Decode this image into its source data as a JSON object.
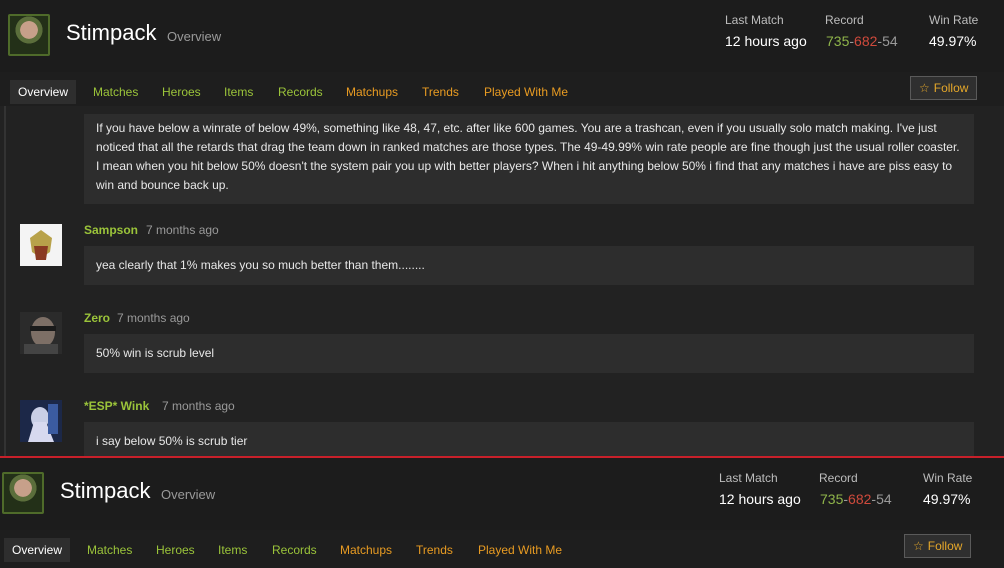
{
  "profile": {
    "name": "Stimpack",
    "section": "Overview",
    "stats": {
      "last_match_label": "Last Match",
      "last_match_value": "12 hours ago",
      "record_label": "Record",
      "record_wins": "735",
      "record_losses": "682",
      "record_abandons": "54",
      "record_sep": "-",
      "win_rate_label": "Win Rate",
      "win_rate_value": "49.97%"
    }
  },
  "nav": {
    "tabs": [
      {
        "label": "Overview"
      },
      {
        "label": "Matches"
      },
      {
        "label": "Heroes"
      },
      {
        "label": "Items"
      },
      {
        "label": "Records"
      },
      {
        "label": "Matchups"
      },
      {
        "label": "Trends"
      },
      {
        "label": "Played With Me"
      }
    ],
    "follow_label": "Follow"
  },
  "comments": [
    {
      "text": "If you have below a winrate of below 49%, something like 48, 47, etc. after like 600 games. You are a trashcan, even if you usually solo match making. I've just noticed that all the retards that drag the team down in ranked matches are those types. The 49-49.99% win rate people are fine though just the usual roller coaster. I mean when you hit below 50% doesn't the system pair you up with better players? When i hit anything below 50% i find that any matches i have are piss easy to win and bounce back up."
    },
    {
      "author": "Sampson",
      "time": "7 months ago",
      "text": "yea clearly that 1% makes you so much better than them........"
    },
    {
      "author": "Zero",
      "time": "7 months ago",
      "text": "50% win is scrub level"
    },
    {
      "author": "*ESP* Wink",
      "time": "7 months ago",
      "text": "i say below 50% is scrub tier"
    }
  ],
  "colors": {
    "accent_green": "#9bc43a",
    "accent_orange": "#e89b22",
    "loss_red": "#d04a3c",
    "divider_red": "#c8202a"
  },
  "icons": {
    "follow": "star-outline-icon"
  }
}
